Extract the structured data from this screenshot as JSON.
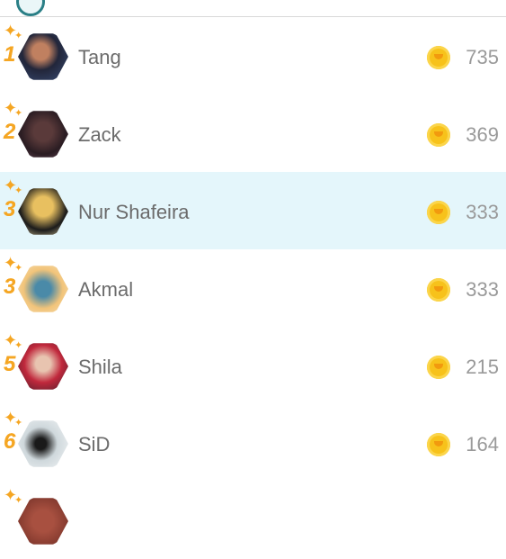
{
  "colors": {
    "highlight": "#e4f6fb",
    "rank": "#f5a623",
    "coin": "#f7c21b"
  },
  "leaderboard": [
    {
      "rank": "1",
      "name": "Tang",
      "score": "735"
    },
    {
      "rank": "2",
      "name": "Zack",
      "score": "369"
    },
    {
      "rank": "3",
      "name": "Nur Shafeira",
      "score": "333",
      "highlighted": true
    },
    {
      "rank": "3",
      "name": "Akmal",
      "score": "333"
    },
    {
      "rank": "5",
      "name": "Shila",
      "score": "215"
    },
    {
      "rank": "6",
      "name": "SiD",
      "score": "164"
    },
    {
      "rank": "",
      "name": "",
      "score": ""
    }
  ]
}
